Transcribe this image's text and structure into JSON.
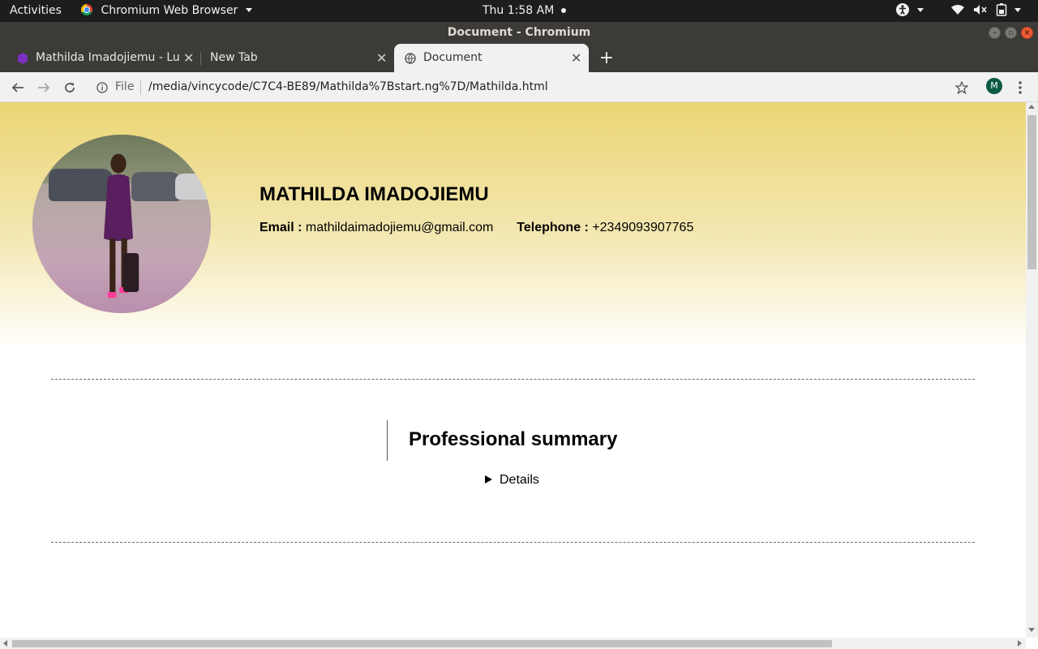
{
  "system": {
    "activities": "Activities",
    "app_menu": "Chromium Web Browser",
    "clock": "Thu  1:58 AM",
    "tray_icons": [
      "accessibility-icon",
      "wifi-icon",
      "volume-muted-icon",
      "battery-icon"
    ]
  },
  "window": {
    "title": "Document - Chromium"
  },
  "tabs": [
    {
      "label": "Mathilda Imadojiemu - Lu",
      "active": false
    },
    {
      "label": "New Tab",
      "active": false
    },
    {
      "label": "Document",
      "active": true
    }
  ],
  "toolbar": {
    "url_scheme": "File",
    "url": "/media/vincycode/C7C4-BE89/Mathilda%7Bstart.ng%7D/Mathilda.html",
    "avatar_letter": "M"
  },
  "page": {
    "name": "MATHILDA IMADOJIEMU",
    "email_label": "Email :",
    "email": "mathildaimadojiemu@gmail.com",
    "telephone_label": "Telephone :",
    "telephone": "+2349093907765",
    "summary_title": "Professional summary",
    "details_label": "Details"
  },
  "colors": {
    "banner_top": "#ebd674",
    "banner_bottom": "#fffefa",
    "profile_color": "#0b5a46"
  }
}
